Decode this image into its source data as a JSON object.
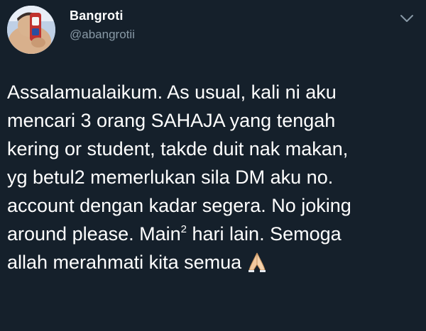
{
  "user": {
    "display_name": "Bangroti",
    "handle": "@abangrotii",
    "avatar_icon": "avatar-photo"
  },
  "menu": {
    "icon": "chevron-down-icon"
  },
  "tweet": {
    "lines": [
      "Assalamualaikum. As usual, kali ni aku",
      "mencari 3 orang SAHAJA yang tengah",
      "kering or student, takde duit nak makan,",
      "yg betul2 memerlukan sila DM aku no.",
      "account dengan kadar segera. No joking",
      "around please. Main",
      "allah merahmati kita semua"
    ],
    "line6_sup": "2",
    "line6_tail": " hari lain. Semoga",
    "emoji": "folded-hands-icon"
  },
  "colors": {
    "background": "#15202b",
    "text": "#ffffff",
    "secondary": "#8899a6"
  }
}
